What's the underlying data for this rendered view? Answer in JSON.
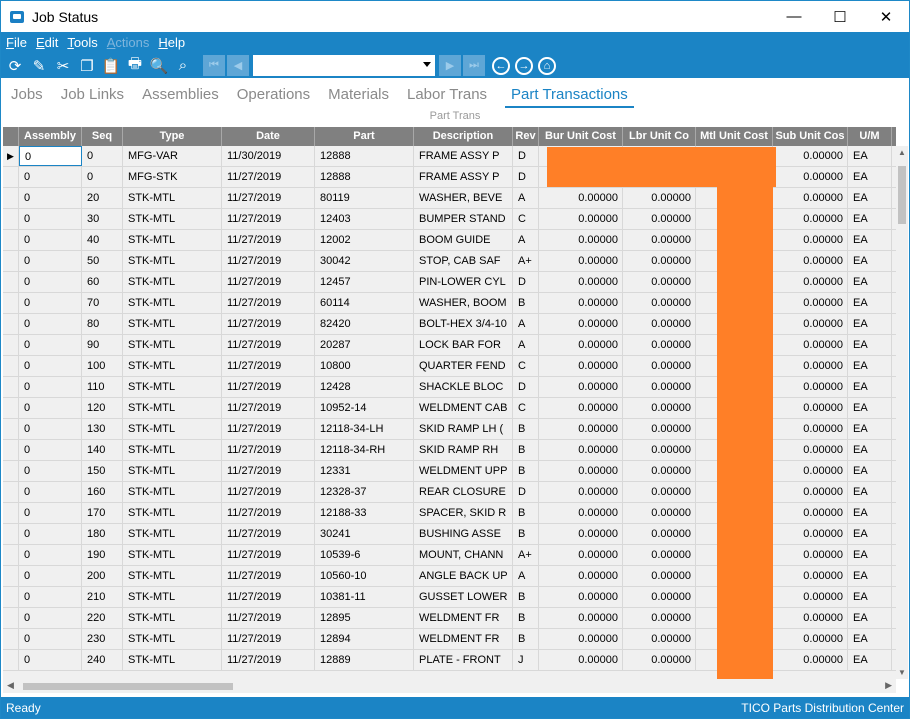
{
  "window": {
    "title": "Job Status",
    "controls": {
      "minimize": "—",
      "maximize": "☐",
      "close": "✕"
    }
  },
  "menu": {
    "items": [
      {
        "label": "File",
        "disabled": false
      },
      {
        "label": "Edit",
        "disabled": false
      },
      {
        "label": "Tools",
        "disabled": false
      },
      {
        "label": "Actions",
        "disabled": true
      },
      {
        "label": "Help",
        "disabled": false
      }
    ]
  },
  "toolbar": {
    "icons": [
      "refresh-icon",
      "clear-icon",
      "cut-icon",
      "copy-icon",
      "paste-icon",
      "print-icon",
      "print-preview-icon",
      "search-binoculars-icon"
    ],
    "glyphs": [
      "⟳",
      "✎",
      "✂",
      "❐",
      "📋",
      "🖶",
      "🔍",
      "⌕"
    ],
    "nav": {
      "first": "⏮",
      "prev": "◀",
      "next": "▶",
      "last": "⏭",
      "combo_value": ""
    },
    "back": "←",
    "forward": "→",
    "home": "⌂"
  },
  "tabs": [
    {
      "label": "Jobs",
      "active": false
    },
    {
      "label": "Job Links",
      "active": false
    },
    {
      "label": "Assemblies",
      "active": false
    },
    {
      "label": "Operations",
      "active": false
    },
    {
      "label": "Materials",
      "active": false
    },
    {
      "label": "Labor Trans",
      "active": false
    },
    {
      "label": "Part Transactions",
      "active": true
    }
  ],
  "section_label": "Part Trans",
  "grid": {
    "columns": [
      "Assembly",
      "Seq",
      "Type",
      "Date",
      "Part",
      "Description",
      "Rev",
      "Bur Unit Cost",
      "Lbr Unit Co",
      "Mtl Unit Cost",
      "Sub Unit Cos",
      "U/M"
    ],
    "current_row_indicator": "▶",
    "rows": [
      [
        "0",
        "0",
        "MFG-VAR",
        "11/30/2019",
        "12888",
        "FRAME ASSY P",
        "D",
        "",
        "",
        "",
        "0.00000",
        "EA"
      ],
      [
        "0",
        "0",
        "MFG-STK",
        "11/27/2019",
        "12888",
        "FRAME ASSY P",
        "D",
        "",
        "",
        "",
        "0.00000",
        "EA"
      ],
      [
        "0",
        "20",
        "STK-MTL",
        "11/27/2019",
        "80119",
        "WASHER, BEVE",
        "A",
        "0.00000",
        "0.00000",
        "",
        "0.00000",
        "EA"
      ],
      [
        "0",
        "30",
        "STK-MTL",
        "11/27/2019",
        "12403",
        "BUMPER STAND",
        "C",
        "0.00000",
        "0.00000",
        "",
        "0.00000",
        "EA"
      ],
      [
        "0",
        "40",
        "STK-MTL",
        "11/27/2019",
        "12002",
        "BOOM GUIDE",
        "A",
        "0.00000",
        "0.00000",
        "",
        "0.00000",
        "EA"
      ],
      [
        "0",
        "50",
        "STK-MTL",
        "11/27/2019",
        "30042",
        "STOP, CAB SAF",
        "A+",
        "0.00000",
        "0.00000",
        "",
        "0.00000",
        "EA"
      ],
      [
        "0",
        "60",
        "STK-MTL",
        "11/27/2019",
        "12457",
        "PIN-LOWER CYL",
        "D",
        "0.00000",
        "0.00000",
        "",
        "0.00000",
        "EA"
      ],
      [
        "0",
        "70",
        "STK-MTL",
        "11/27/2019",
        "60114",
        "WASHER, BOOM",
        "B",
        "0.00000",
        "0.00000",
        "",
        "0.00000",
        "EA"
      ],
      [
        "0",
        "80",
        "STK-MTL",
        "11/27/2019",
        "82420",
        "BOLT-HEX 3/4-10",
        "A",
        "0.00000",
        "0.00000",
        "",
        "0.00000",
        "EA"
      ],
      [
        "0",
        "90",
        "STK-MTL",
        "11/27/2019",
        "20287",
        "LOCK BAR FOR",
        "A",
        "0.00000",
        "0.00000",
        "",
        "0.00000",
        "EA"
      ],
      [
        "0",
        "100",
        "STK-MTL",
        "11/27/2019",
        "10800",
        "QUARTER FEND",
        "C",
        "0.00000",
        "0.00000",
        "",
        "0.00000",
        "EA"
      ],
      [
        "0",
        "110",
        "STK-MTL",
        "11/27/2019",
        "12428",
        "SHACKLE BLOC",
        "D",
        "0.00000",
        "0.00000",
        "",
        "0.00000",
        "EA"
      ],
      [
        "0",
        "120",
        "STK-MTL",
        "11/27/2019",
        "10952-14",
        "WELDMENT CAB",
        "C",
        "0.00000",
        "0.00000",
        "",
        "0.00000",
        "EA"
      ],
      [
        "0",
        "130",
        "STK-MTL",
        "11/27/2019",
        "12118-34-LH",
        "SKID RAMP LH (",
        "B",
        "0.00000",
        "0.00000",
        "",
        "0.00000",
        "EA"
      ],
      [
        "0",
        "140",
        "STK-MTL",
        "11/27/2019",
        "12118-34-RH",
        "SKID RAMP RH",
        "B",
        "0.00000",
        "0.00000",
        "",
        "0.00000",
        "EA"
      ],
      [
        "0",
        "150",
        "STK-MTL",
        "11/27/2019",
        "12331",
        "WELDMENT UPP",
        "B",
        "0.00000",
        "0.00000",
        "",
        "0.00000",
        "EA"
      ],
      [
        "0",
        "160",
        "STK-MTL",
        "11/27/2019",
        "12328-37",
        "REAR CLOSURE",
        "D",
        "0.00000",
        "0.00000",
        "",
        "0.00000",
        "EA"
      ],
      [
        "0",
        "170",
        "STK-MTL",
        "11/27/2019",
        "12188-33",
        "SPACER, SKID R",
        "B",
        "0.00000",
        "0.00000",
        "",
        "0.00000",
        "EA"
      ],
      [
        "0",
        "180",
        "STK-MTL",
        "11/27/2019",
        "30241",
        "BUSHING ASSE",
        "B",
        "0.00000",
        "0.00000",
        "",
        "0.00000",
        "EA"
      ],
      [
        "0",
        "190",
        "STK-MTL",
        "11/27/2019",
        "10539-6",
        "MOUNT, CHANN",
        "A+",
        "0.00000",
        "0.00000",
        "",
        "0.00000",
        "EA"
      ],
      [
        "0",
        "200",
        "STK-MTL",
        "11/27/2019",
        "10560-10",
        "ANGLE BACK UP",
        "A",
        "0.00000",
        "0.00000",
        "",
        "0.00000",
        "EA"
      ],
      [
        "0",
        "210",
        "STK-MTL",
        "11/27/2019",
        "10381-11",
        "GUSSET LOWER",
        "B",
        "0.00000",
        "0.00000",
        "",
        "0.00000",
        "EA"
      ],
      [
        "0",
        "220",
        "STK-MTL",
        "11/27/2019",
        "12895",
        "WELDMENT FR",
        "B",
        "0.00000",
        "0.00000",
        "",
        "0.00000",
        "EA"
      ],
      [
        "0",
        "230",
        "STK-MTL",
        "11/27/2019",
        "12894",
        "WELDMENT FR",
        "B",
        "0.00000",
        "0.00000",
        "",
        "0.00000",
        "EA"
      ],
      [
        "0",
        "240",
        "STK-MTL",
        "11/27/2019",
        "12889",
        "PLATE - FRONT",
        "J",
        "0.00000",
        "0.00000",
        "",
        "0.00000",
        "EA"
      ]
    ]
  },
  "status": {
    "left": "Ready",
    "right": "TICO Parts Distribution Center"
  },
  "colors": {
    "accent": "#1b84c5",
    "redaction": "#ff7f27",
    "header_bg": "#808080"
  }
}
